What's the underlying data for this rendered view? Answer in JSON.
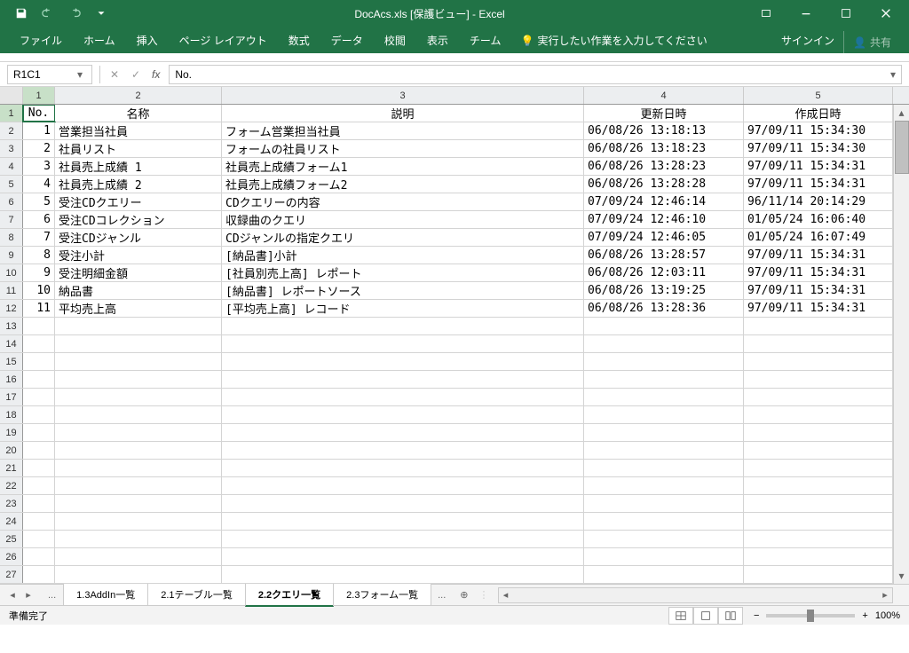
{
  "title": "DocAcs.xls  [保護ビュー] - Excel",
  "qat": {
    "save": "save",
    "undo": "undo",
    "redo": "redo"
  },
  "ribbon": {
    "file": "ファイル",
    "home": "ホーム",
    "insert": "挿入",
    "layout": "ページ レイアウト",
    "formulas": "数式",
    "data": "データ",
    "review": "校閲",
    "view": "表示",
    "team": "チーム",
    "tellme": "実行したい作業を入力してください",
    "signin": "サインイン",
    "share": "共有"
  },
  "namebox": "R1C1",
  "fxvalue": "No.",
  "columns": {
    "c1": "1",
    "c2": "2",
    "c3": "3",
    "c4": "4",
    "c5": "5"
  },
  "headers": {
    "no": "No.",
    "name": "名称",
    "desc": "説明",
    "updated": "更新日時",
    "created": "作成日時"
  },
  "rows": [
    {
      "n": "1",
      "name": "営業担当社員",
      "desc": "フォーム営業担当社員",
      "upd": "06/08/26 13:18:13",
      "crt": "97/09/11 15:34:30"
    },
    {
      "n": "2",
      "name": "社員リスト",
      "desc": "フォームの社員リスト",
      "upd": "06/08/26 13:18:23",
      "crt": "97/09/11 15:34:30"
    },
    {
      "n": "3",
      "name": "社員売上成績 1",
      "desc": "社員売上成績フォーム1",
      "upd": "06/08/26 13:28:23",
      "crt": "97/09/11 15:34:31"
    },
    {
      "n": "4",
      "name": "社員売上成績 2",
      "desc": "社員売上成績フォーム2",
      "upd": "06/08/26 13:28:28",
      "crt": "97/09/11 15:34:31"
    },
    {
      "n": "5",
      "name": "受注CDクエリー",
      "desc": "CDクエリーの内容",
      "upd": "07/09/24 12:46:14",
      "crt": "96/11/14 20:14:29"
    },
    {
      "n": "6",
      "name": "受注CDコレクション",
      "desc": "収録曲のクエリ",
      "upd": "07/09/24 12:46:10",
      "crt": "01/05/24 16:06:40"
    },
    {
      "n": "7",
      "name": "受注CDジャンル",
      "desc": "CDジャンルの指定クエリ",
      "upd": "07/09/24 12:46:05",
      "crt": "01/05/24 16:07:49"
    },
    {
      "n": "8",
      "name": "受注小計",
      "desc": "[納品書]小計",
      "upd": "06/08/26 13:28:57",
      "crt": "97/09/11 15:34:31"
    },
    {
      "n": "9",
      "name": "受注明細金額",
      "desc": "[社員別売上高] レポート",
      "upd": "06/08/26 12:03:11",
      "crt": "97/09/11 15:34:31"
    },
    {
      "n": "10",
      "name": "納品書",
      "desc": "[納品書] レポートソース",
      "upd": "06/08/26 13:19:25",
      "crt": "97/09/11 15:34:31"
    },
    {
      "n": "11",
      "name": "平均売上高",
      "desc": "[平均売上高] レコード",
      "upd": "06/08/26 13:28:36",
      "crt": "97/09/11 15:34:31"
    }
  ],
  "emptyRows": [
    "13",
    "14",
    "15",
    "16",
    "17",
    "18",
    "19",
    "20",
    "21",
    "22",
    "23",
    "24",
    "25",
    "26",
    "27"
  ],
  "sheets": {
    "t1": "1.3AddIn一覧",
    "t2": "2.1テーブル一覧",
    "t3": "2.2クエリ一覧",
    "t4": "2.3フォーム一覧"
  },
  "status": {
    "ready": "準備完了",
    "zoom": "100%"
  }
}
